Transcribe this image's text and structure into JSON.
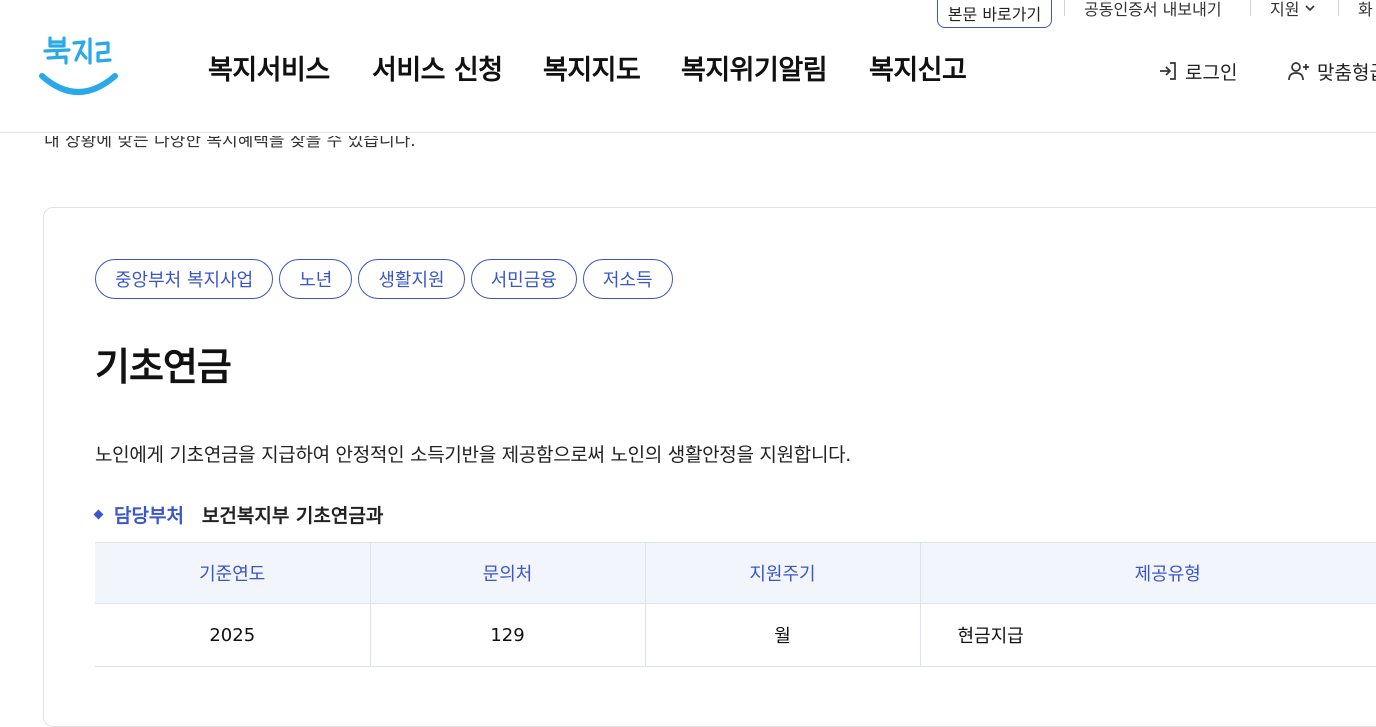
{
  "utility": {
    "skip_link": "본문 바로가기",
    "cert_export": "공동인증서 내보내기",
    "support": "지원",
    "screen_cut": "화"
  },
  "header": {
    "logo_text": "복지로",
    "nav": [
      "복지서비스",
      "서비스 신청",
      "복지지도",
      "복지위기알림",
      "복지신고"
    ],
    "login": "로그인",
    "custom": "맞춤형급"
  },
  "intro_line": "내 상황에 맞는 다양한 복지혜택을 찾을 수 있습니다.",
  "service": {
    "tags": [
      "중앙부처 복지사업",
      "노년",
      "생활지원",
      "서민금융",
      "저소득"
    ],
    "title": "기초연금",
    "description": "노인에게 기초연금을 지급하여 안정적인 소득기반을 제공함으로써 노인의 생활안정을 지원합니다.",
    "dept_label": "담당부처",
    "dept_value": "보건복지부 기초연금과",
    "table": {
      "headers": [
        "기준연도",
        "문의처",
        "지원주기",
        "제공유형"
      ],
      "row": [
        "2025",
        "129",
        "월",
        "현금지급"
      ]
    }
  },
  "colors": {
    "accent": "#3a56c8",
    "table_header_bg": "#f2f5fb",
    "logo_blue": "#29a9e8"
  }
}
